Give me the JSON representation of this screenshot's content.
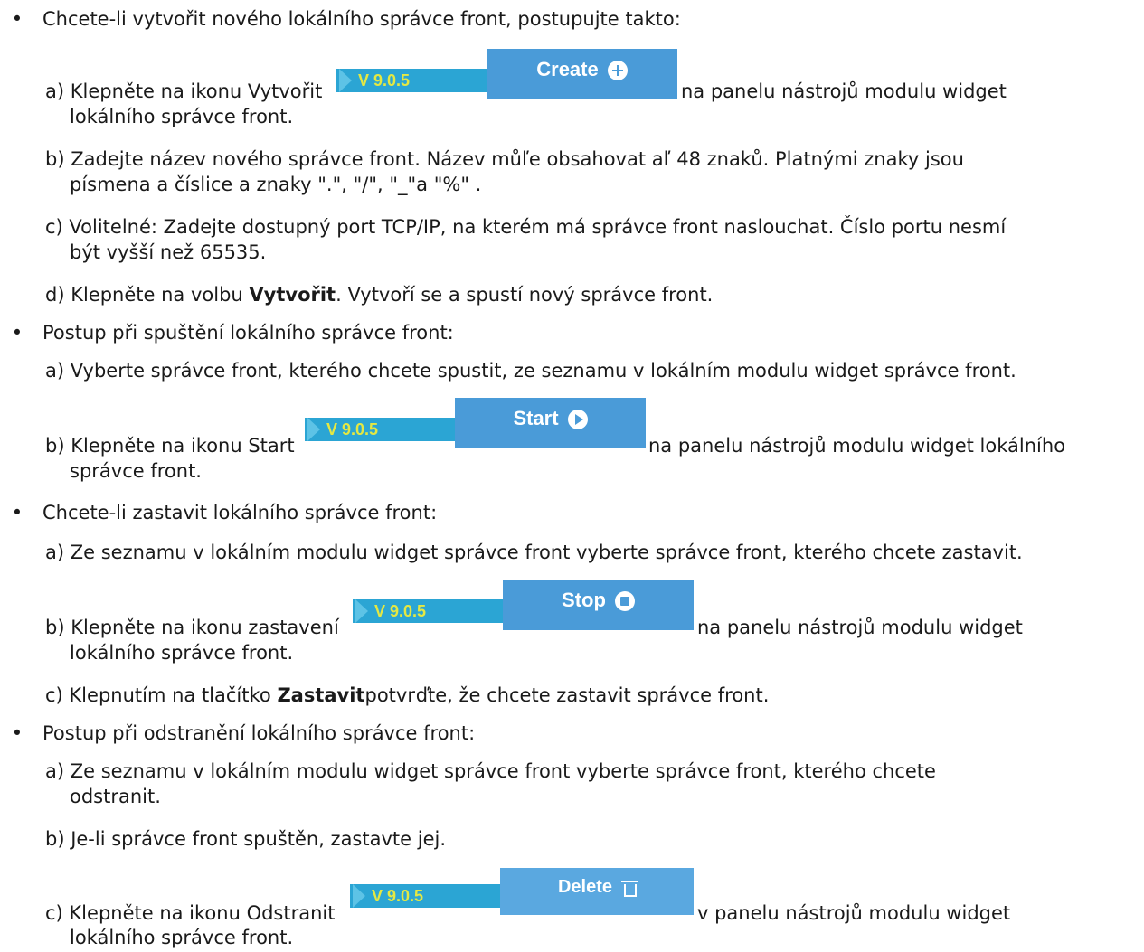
{
  "bullets": [
    "Chcete-li vytvořit nového lokálního správce front, postupujte takto:",
    "Postup při spuštění lokálního správce front:",
    "Chcete-li zastavit lokálního správce front:",
    "Postup při odstranění lokálního správce front:"
  ],
  "steps": {
    "create_a_before": "a) Klepněte na ikonu Vytvořit ",
    "create_a_after": " na panelu nástrojů modulu widget",
    "create_a_cont": "lokálního správce front.",
    "create_b1": "b) Zadejte název nového správce front. Název můľe obsahovat aľ 48 znaků. Platnými znaky jsou",
    "create_b2": "písmena a číslice a znaky \".\", \"/\", \"_\"a \"%\" .",
    "create_c1": "c) Volitelné: Zadejte dostupný port TCP/IP, na kterém má správce front naslouchat. Číslo portu nesmí",
    "create_c2": "být vyšší než 65535.",
    "create_d_pre": "d) Klepněte na volbu ",
    "create_d_bold": "Vytvořit",
    "create_d_post": ". Vytvoří se a spustí nový správce front.",
    "start_a": "a) Vyberte správce front, kterého chcete spustit, ze seznamu v lokálním modulu widget správce front.",
    "start_b_before": "b) Klepněte na ikonu Start ",
    "start_b_after": " na panelu nástrojů modulu widget lokálního",
    "start_b_cont": "správce front.",
    "stop_a": "a) Ze seznamu v lokálním modulu widget správce front vyberte správce front, kterého chcete zastavit.",
    "stop_b_before": "b) Klepněte na ikonu zastavení ",
    "stop_b_after": " na panelu nástrojů modulu widget",
    "stop_b_cont": "lokálního správce front.",
    "stop_c_pre": "c) Klepnutím na tlačítko ",
    "stop_c_bold": "Zastavit",
    "stop_c_post": "potvrďte, že chcete zastavit správce front.",
    "del_a1": "a) Ze seznamu v lokálním modulu widget správce front vyberte správce front, kterého chcete",
    "del_a2": "odstranit.",
    "del_b": "b) Je-li správce front spuštěn, zastavte jej.",
    "del_c_before": "c) Klepněte na ikonu Odstranit ",
    "del_c_after": " v panelu nástrojů modulu widget",
    "del_c_cont": "lokálního správce front."
  },
  "icons": {
    "version": "V 9.0.5",
    "create": "Create",
    "start": "Start",
    "stop": "Stop",
    "delete": "Delete"
  }
}
